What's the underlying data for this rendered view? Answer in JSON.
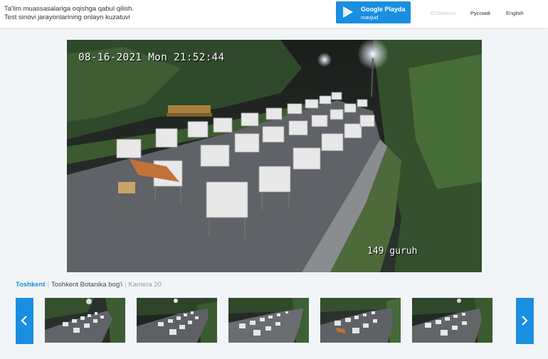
{
  "header": {
    "title_line1": "Ta'lim muassasalariga oqishga qabul qilish.",
    "title_line2": "Test sinovi jarayonlarining onlayn kuzatuvi",
    "google_play": {
      "title": "Google Playda",
      "subtitle": "mavjud",
      "icon": "play-icon"
    },
    "languages": [
      {
        "label": "O'zbekcha",
        "active": false
      },
      {
        "label": "Русский",
        "active": true
      },
      {
        "label": "English",
        "active": true
      }
    ]
  },
  "camera": {
    "timestamp": "08-16-2021 Mon 21:52:44",
    "group_label": "149 guruh"
  },
  "breadcrumb": {
    "region": "Toshkent",
    "location": "Toshkent Botanika bog'i",
    "camera": "Kamera 20"
  },
  "thumbnails": {
    "prev_icon": "chevron-left-icon",
    "next_icon": "chevron-right-icon",
    "count": 5
  },
  "colors": {
    "accent": "#1a8ee0",
    "background": "#f2f5f8"
  }
}
